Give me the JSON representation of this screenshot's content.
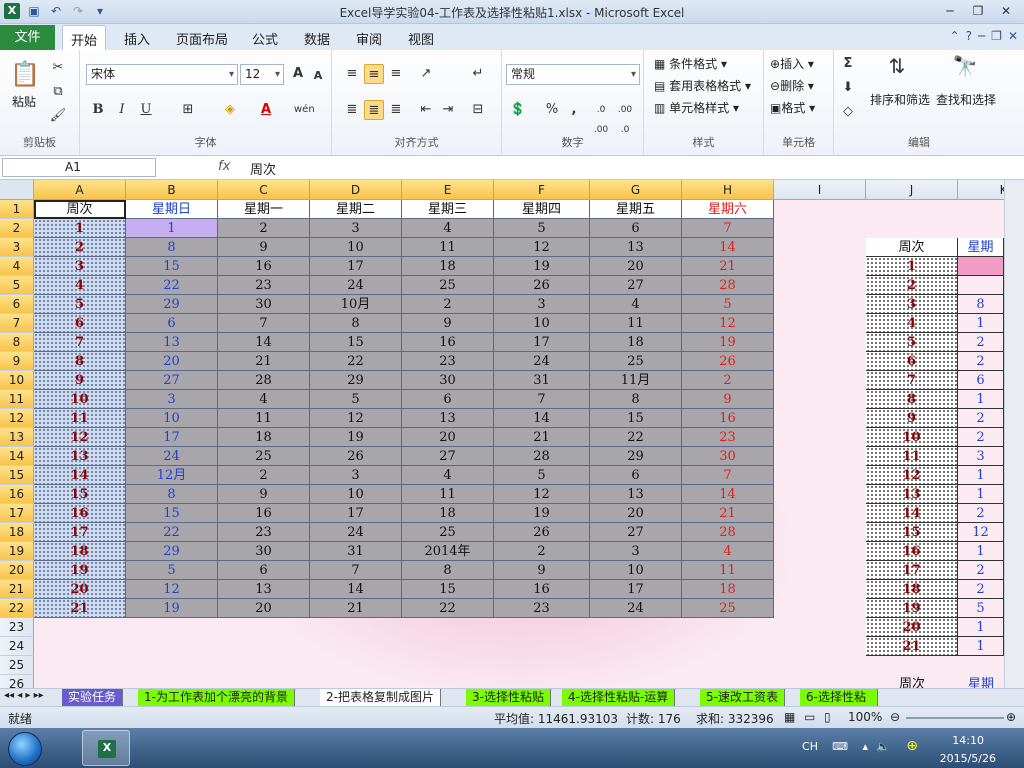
{
  "window": {
    "title": "Excel导学实验04-工作表及选择性粘贴1.xlsx  -  Microsoft Excel"
  },
  "qat": {
    "save": "save-icon",
    "undo": "undo-icon",
    "redo": "redo-icon",
    "customize": "▾"
  },
  "tabs": {
    "file": "文件",
    "items": [
      "开始",
      "插入",
      "页面布局",
      "公式",
      "数据",
      "审阅",
      "视图"
    ]
  },
  "ribbon": {
    "clipboard": {
      "label": "剪贴板",
      "paste": "粘贴"
    },
    "font": {
      "label": "字体",
      "name": "宋体",
      "size": "12",
      "bold": "B",
      "italic": "I",
      "underline": "U",
      "grow": "A",
      "shrink": "A",
      "wen": "wén"
    },
    "align": {
      "label": "对齐方式"
    },
    "number": {
      "label": "数字",
      "format": "常规",
      "percent": "%",
      "comma": ",",
      "inc": ".0 .00",
      "dec": ".00 .0"
    },
    "styles": {
      "label": "样式",
      "cond": "条件格式",
      "table": "套用表格格式",
      "cell": "单元格样式"
    },
    "cells": {
      "label": "单元格",
      "insert": "插入",
      "delete": "删除",
      "format": "格式"
    },
    "edit": {
      "label": "编辑",
      "sigma": "Σ",
      "sort": "排序和筛选",
      "find": "查找和选择"
    }
  },
  "formula": {
    "namebox": "A1",
    "fx": "fx",
    "content": "周次"
  },
  "columns": [
    "A",
    "B",
    "C",
    "D",
    "E",
    "F",
    "G",
    "H",
    "I",
    "J",
    "K"
  ],
  "rows": [
    "1",
    "2",
    "3",
    "4",
    "5",
    "6",
    "7",
    "8",
    "9",
    "10",
    "11",
    "12",
    "13",
    "14",
    "15",
    "16",
    "17",
    "18",
    "19",
    "20",
    "21",
    "22",
    "23",
    "24",
    "25",
    "26"
  ],
  "table": {
    "header": [
      "周次",
      "星期日",
      "星期一",
      "星期二",
      "星期三",
      "星期四",
      "星期五",
      "星期六"
    ],
    "rows": [
      [
        "1",
        "1",
        "2",
        "3",
        "4",
        "5",
        "6",
        "7"
      ],
      [
        "2",
        "8",
        "9",
        "10",
        "11",
        "12",
        "13",
        "14"
      ],
      [
        "3",
        "15",
        "16",
        "17",
        "18",
        "19",
        "20",
        "21"
      ],
      [
        "4",
        "22",
        "23",
        "24",
        "25",
        "26",
        "27",
        "28"
      ],
      [
        "5",
        "29",
        "30",
        "10月",
        "2",
        "3",
        "4",
        "5"
      ],
      [
        "6",
        "6",
        "7",
        "8",
        "9",
        "10",
        "11",
        "12"
      ],
      [
        "7",
        "13",
        "14",
        "15",
        "16",
        "17",
        "18",
        "19"
      ],
      [
        "8",
        "20",
        "21",
        "22",
        "23",
        "24",
        "25",
        "26"
      ],
      [
        "9",
        "27",
        "28",
        "29",
        "30",
        "31",
        "11月",
        "2"
      ],
      [
        "10",
        "3",
        "4",
        "5",
        "6",
        "7",
        "8",
        "9"
      ],
      [
        "11",
        "10",
        "11",
        "12",
        "13",
        "14",
        "15",
        "16"
      ],
      [
        "12",
        "17",
        "18",
        "19",
        "20",
        "21",
        "22",
        "23"
      ],
      [
        "13",
        "24",
        "25",
        "26",
        "27",
        "28",
        "29",
        "30"
      ],
      [
        "14",
        "12月",
        "2",
        "3",
        "4",
        "5",
        "6",
        "7"
      ],
      [
        "15",
        "8",
        "9",
        "10",
        "11",
        "12",
        "13",
        "14"
      ],
      [
        "16",
        "15",
        "16",
        "17",
        "18",
        "19",
        "20",
        "21"
      ],
      [
        "17",
        "22",
        "23",
        "24",
        "25",
        "26",
        "27",
        "28"
      ],
      [
        "18",
        "29",
        "30",
        "31",
        "2014年",
        "2",
        "3",
        "4"
      ],
      [
        "19",
        "5",
        "6",
        "7",
        "8",
        "9",
        "10",
        "11"
      ],
      [
        "20",
        "12",
        "13",
        "14",
        "15",
        "16",
        "17",
        "18"
      ],
      [
        "21",
        "19",
        "20",
        "21",
        "22",
        "23",
        "24",
        "25"
      ]
    ]
  },
  "right": {
    "header": [
      "周次",
      "星期"
    ],
    "weeks": [
      "1",
      "2",
      "3",
      "4",
      "5",
      "6",
      "7",
      "8",
      "9",
      "10",
      "11",
      "12",
      "13",
      "14",
      "15",
      "16",
      "17",
      "18",
      "19",
      "20",
      "21"
    ],
    "k": [
      "",
      "8",
      "1",
      "2",
      "2",
      "6",
      "1",
      "2",
      "2",
      "3",
      "1",
      "1",
      "2",
      "12",
      "1",
      "2",
      "2",
      "5",
      "1",
      "1"
    ],
    "bottom": [
      "周次",
      "星期"
    ]
  },
  "sheets": [
    "实验任务",
    "1-为工作表加个漂亮的背景",
    "2-把表格复制成图片",
    "3-选择性粘贴",
    "4-选择性粘贴-运算",
    "5-速改工资表",
    "6-选择性粘"
  ],
  "status": {
    "ready": "就绪",
    "avg": "平均值: 11461.93103",
    "count": "计数: 176",
    "sum": "求和: 332396",
    "zoom": "100%"
  },
  "tray": {
    "lang": "CH",
    "time": "14:10",
    "date": "2015/5/26"
  }
}
